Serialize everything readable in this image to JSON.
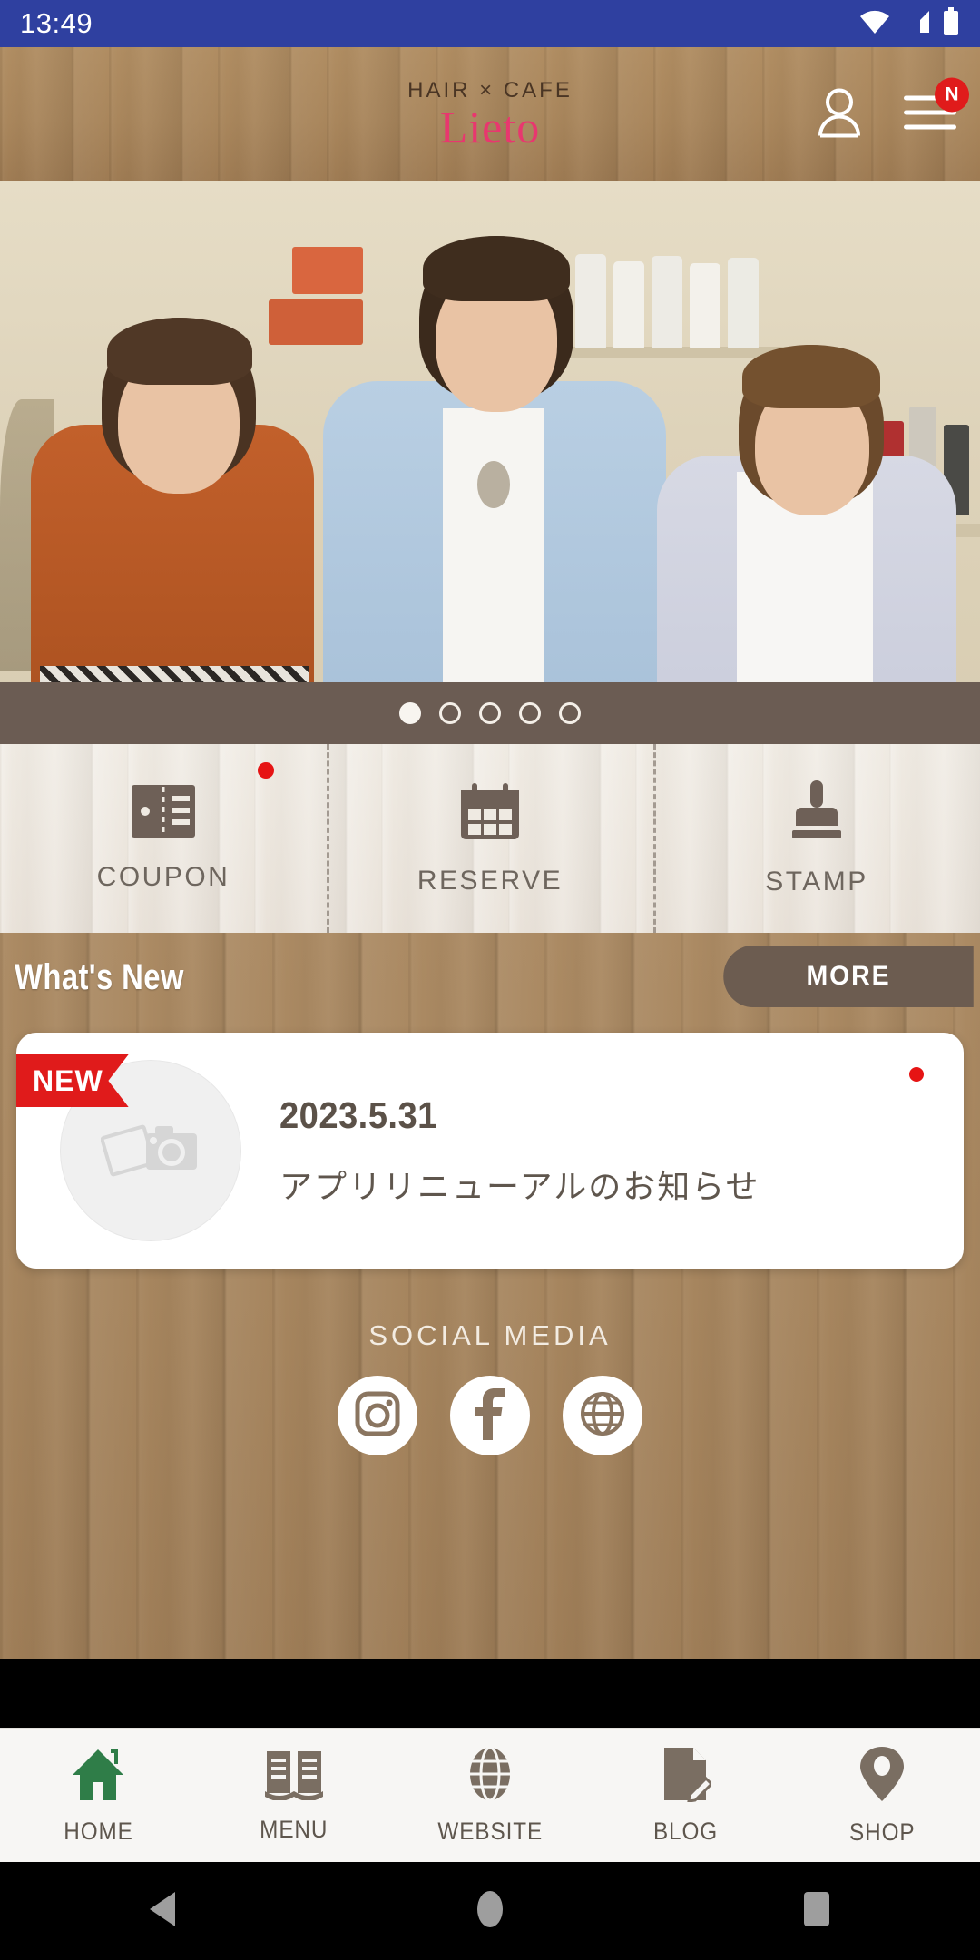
{
  "status_bar": {
    "time": "13:49",
    "icons": [
      "wifi-icon",
      "cellular-signal-icon",
      "battery-icon"
    ]
  },
  "header": {
    "logo_top": "HAIR × CAFE",
    "logo_main": "Lieto",
    "account_icon": "person-icon",
    "menu_icon": "hamburger-menu-icon",
    "menu_badge": "N"
  },
  "hero": {
    "alt": "Three salon staff standing together in the hair salon",
    "slide_count": 5,
    "active_slide": 1
  },
  "quick_actions": [
    {
      "label": "COUPON",
      "icon": "coupon-ticket-icon",
      "has_badge": true
    },
    {
      "label": "RESERVE",
      "icon": "calendar-icon",
      "has_badge": false
    },
    {
      "label": "STAMP",
      "icon": "stamp-icon",
      "has_badge": false
    }
  ],
  "whats_new": {
    "title": "What's New",
    "more_label": "MORE",
    "items": [
      {
        "badge": "NEW",
        "date": "2023.5.31",
        "title": "アプリリニューアルのお知らせ",
        "thumb_icon": "photo-camera-placeholder-icon",
        "unread": true
      }
    ]
  },
  "social": {
    "title": "SOCIAL MEDIA",
    "links": [
      {
        "name": "instagram-icon",
        "label": "Instagram"
      },
      {
        "name": "facebook-icon",
        "label": "Facebook"
      },
      {
        "name": "website-globe-icon",
        "label": "Website"
      }
    ]
  },
  "tab_bar": {
    "active_index": 0,
    "active_color": "#2f7d48",
    "inactive_color": "#7a6e62",
    "items": [
      {
        "label": "HOME",
        "icon": "home-icon"
      },
      {
        "label": "MENU",
        "icon": "book-icon"
      },
      {
        "label": "WEBSITE",
        "icon": "globe-icon"
      },
      {
        "label": "BLOG",
        "icon": "document-pen-icon"
      },
      {
        "label": "SHOP",
        "icon": "map-pin-icon"
      }
    ]
  },
  "android_nav": {
    "back": "back-triangle-icon",
    "home": "home-circle-icon",
    "recents": "recents-square-icon"
  },
  "colors": {
    "status_bar": "#2f40a0",
    "brand_pink": "#e8376f",
    "wood_dark": "#a6855e",
    "wood_light": "#e9e2d9",
    "brown": "#6c5c50",
    "red_badge": "#e01b1b"
  }
}
